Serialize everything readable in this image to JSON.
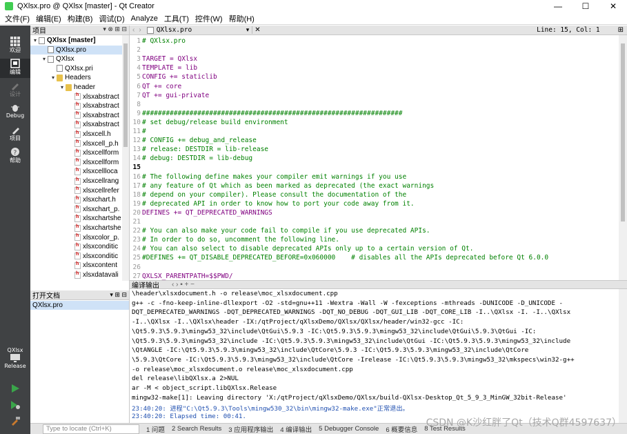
{
  "window": {
    "title": "QXlsx.pro @ QXlsx [master] - Qt Creator",
    "minimize": "—",
    "maximize": "☐",
    "close": "✕"
  },
  "menu": [
    "文件(F)",
    "编辑(E)",
    "构建(B)",
    "调试(D)",
    "Analyze",
    "工具(T)",
    "控件(W)",
    "帮助(H)"
  ],
  "modes": [
    {
      "label": "欢迎"
    },
    {
      "label": "编辑"
    },
    {
      "label": "设计"
    },
    {
      "label": "Debug"
    },
    {
      "label": "项目"
    },
    {
      "label": "帮助"
    }
  ],
  "kit": {
    "project": "QXlsx",
    "config": "Release"
  },
  "sidebar": {
    "title": "项目",
    "tree": [
      {
        "label": "QXlsx [master]",
        "bold": true,
        "arrow": "▾",
        "icon": "pro",
        "level": 0
      },
      {
        "label": "QXlsx.pro",
        "arrow": "",
        "icon": "pro",
        "level": 1,
        "selected": true
      },
      {
        "label": "QXlsx",
        "arrow": "▾",
        "icon": "pro",
        "level": 1
      },
      {
        "label": "QXlsx.pri",
        "arrow": "",
        "icon": "pro",
        "level": 2
      },
      {
        "label": "Headers",
        "arrow": "▾",
        "icon": "fold",
        "level": 2
      },
      {
        "label": "header",
        "arrow": "▾",
        "icon": "fold",
        "level": 3
      },
      {
        "label": "xlsxabstract",
        "arrow": "",
        "icon": "h",
        "level": 4
      },
      {
        "label": "xlsxabstract",
        "arrow": "",
        "icon": "h",
        "level": 4
      },
      {
        "label": "xlsxabstract",
        "arrow": "",
        "icon": "h",
        "level": 4
      },
      {
        "label": "xlsxabstract",
        "arrow": "",
        "icon": "h",
        "level": 4
      },
      {
        "label": "xlsxcell.h",
        "arrow": "",
        "icon": "h",
        "level": 4
      },
      {
        "label": "xlsxcell_p.h",
        "arrow": "",
        "icon": "h",
        "level": 4
      },
      {
        "label": "xlsxcellform",
        "arrow": "",
        "icon": "h",
        "level": 4
      },
      {
        "label": "xlsxcellform",
        "arrow": "",
        "icon": "h",
        "level": 4
      },
      {
        "label": "xlsxcellloca",
        "arrow": "",
        "icon": "h",
        "level": 4
      },
      {
        "label": "xlsxcellrang",
        "arrow": "",
        "icon": "h",
        "level": 4
      },
      {
        "label": "xlsxcellrefer",
        "arrow": "",
        "icon": "h",
        "level": 4
      },
      {
        "label": "xlsxchart.h",
        "arrow": "",
        "icon": "h",
        "level": 4
      },
      {
        "label": "xlsxchart_p.",
        "arrow": "",
        "icon": "h",
        "level": 4
      },
      {
        "label": "xlsxchartshe",
        "arrow": "",
        "icon": "h",
        "level": 4
      },
      {
        "label": "xlsxchartshe",
        "arrow": "",
        "icon": "h",
        "level": 4
      },
      {
        "label": "xlsxcolor_p.",
        "arrow": "",
        "icon": "h",
        "level": 4
      },
      {
        "label": "xlsxconditic",
        "arrow": "",
        "icon": "h",
        "level": 4
      },
      {
        "label": "xlsxconditic",
        "arrow": "",
        "icon": "h",
        "level": 4
      },
      {
        "label": "xlsxcontent",
        "arrow": "",
        "icon": "h",
        "level": 4
      },
      {
        "label": "xlsxdatavali",
        "arrow": "",
        "icon": "h",
        "level": 4
      }
    ],
    "open_title": "打开文档",
    "open_files": [
      "QXlsx.pro"
    ]
  },
  "editor": {
    "file": "QXlsx.pro",
    "position": "Line: 15, Col: 1",
    "lines": [
      {
        "n": "1",
        "t": "# QXlsx.pro",
        "c": "com"
      },
      {
        "n": "2",
        "t": "",
        "c": ""
      },
      {
        "n": "3",
        "t": "TARGET = QXlsx",
        "c": "key"
      },
      {
        "n": "4",
        "t": "TEMPLATE = lib",
        "c": "key"
      },
      {
        "n": "5",
        "t": "CONFIG += staticlib",
        "c": "key"
      },
      {
        "n": "6",
        "t": "QT += core",
        "c": "key"
      },
      {
        "n": "7",
        "t": "QT += gui-private",
        "c": "key"
      },
      {
        "n": "8",
        "t": "",
        "c": ""
      },
      {
        "n": "9",
        "t": "##################################################################",
        "c": "com"
      },
      {
        "n": "10",
        "t": "# set debug/release build environment",
        "c": "com"
      },
      {
        "n": "11",
        "t": "#",
        "c": "com"
      },
      {
        "n": "12",
        "t": "# CONFIG += debug_and_release",
        "c": "com"
      },
      {
        "n": "13",
        "t": "# release: DESTDIR = lib-release",
        "c": "com"
      },
      {
        "n": "14",
        "t": "# debug: DESTDIR = lib-debug",
        "c": "com"
      },
      {
        "n": "15",
        "t": "",
        "c": ""
      },
      {
        "n": "16",
        "t": "# The following define makes your compiler emit warnings if you use",
        "c": "com"
      },
      {
        "n": "17",
        "t": "# any feature of Qt which as been marked as deprecated (the exact warnings",
        "c": "com"
      },
      {
        "n": "18",
        "t": "# depend on your compiler). Please consult the documentation of the",
        "c": "com"
      },
      {
        "n": "19",
        "t": "# deprecated API in order to know how to port your code away from it.",
        "c": "com"
      },
      {
        "n": "20",
        "t": "DEFINES += QT_DEPRECATED_WARNINGS",
        "c": "key"
      },
      {
        "n": "21",
        "t": "",
        "c": ""
      },
      {
        "n": "22",
        "t": "# You can also make your code fail to compile if you use deprecated APIs.",
        "c": "com"
      },
      {
        "n": "23",
        "t": "# In order to do so, uncomment the following line.",
        "c": "com"
      },
      {
        "n": "24",
        "t": "# You can also select to disable deprecated APIs only up to a certain version of Qt.",
        "c": "com"
      },
      {
        "n": "25",
        "t": "#DEFINES += QT_DISABLE_DEPRECATED_BEFORE=0x060000    # disables all the APIs deprecated before Qt 6.0.0",
        "c": "com"
      },
      {
        "n": "26",
        "t": "",
        "c": ""
      },
      {
        "n": "27",
        "t": "QXLSX_PARENTPATH=$$PWD/",
        "c": "key"
      }
    ]
  },
  "output": {
    "title": "编译输出",
    "lines": [
      {
        "t": "\\header\\xlsxdocument.h -o release\\moc_xlsxdocument.cpp",
        "blue": false
      },
      {
        "t": "g++ -c -fno-keep-inline-dllexport -O2 -std=gnu++11 -Wextra -Wall -W -fexceptions -mthreads -DUNICODE -D_UNICODE -",
        "blue": false
      },
      {
        "t": "DQT_DEPRECATED_WARNINGS -DQT_DEPRECATED_WARNINGS -DQT_NO_DEBUG -DQT_GUI_LIB -DQT_CORE_LIB -I..\\QXlsx -I. -I..\\QXlsx",
        "blue": false
      },
      {
        "t": "-I..\\QXlsx -I..\\QXlsx\\header -IX:/qtProject/qXlsxDemo/QXlsx/QXlsx/header/win32-gcc -IC:",
        "blue": false
      },
      {
        "t": "\\Qt5.9.3\\5.9.3\\mingw53_32\\include\\QtGui\\5.9.3 -IC:\\Qt5.9.3\\5.9.3\\mingw53_32\\include\\QtGui\\5.9.3\\QtGui -IC:",
        "blue": false
      },
      {
        "t": "\\Qt5.9.3\\5.9.3\\mingw53_32\\include -IC:\\Qt5.9.3\\5.9.3\\mingw53_32\\include\\QtGui -IC:\\Qt5.9.3\\5.9.3\\mingw53_32\\include",
        "blue": false
      },
      {
        "t": "\\QtANGLE -IC:\\Qt5.9.3\\5.9.3\\mingw53_32\\include\\QtCore\\5.9.3 -IC:\\Qt5.9.3\\5.9.3\\mingw53_32\\include\\QtCore",
        "blue": false
      },
      {
        "t": "\\5.9.3\\QtCore -IC:\\Qt5.9.3\\5.9.3\\mingw53_32\\include\\QtCore -Irelease -IC:\\Qt5.9.3\\5.9.3\\mingw53_32\\mkspecs\\win32-g++",
        "blue": false
      },
      {
        "t": "-o release\\moc_xlsxdocument.o release\\moc_xlsxdocument.cpp",
        "blue": false
      },
      {
        "t": "del release\\libQXlsx.a 2>NUL",
        "blue": false
      },
      {
        "t": "ar -M < object_script.libQXlsx.Release",
        "blue": false
      },
      {
        "t": "mingw32-make[1]: Leaving directory 'X:/qtProject/qXlsxDemo/QXlsx/build-QXlsx-Desktop_Qt_5_9_3_MinGW_32bit-Release'",
        "blue": false
      },
      {
        "t": "23:40:20: 进程\"C:\\Qt5.9.3\\Tools\\mingw530_32\\bin\\mingw32-make.exe\"正常退出。",
        "blue": true
      },
      {
        "t": "23:40:20: Elapsed time: 00:41.",
        "blue": true
      }
    ]
  },
  "status": {
    "locator_placeholder": "Type to locate (Ctrl+K)",
    "tabs": [
      "1 问题",
      "2 Search Results",
      "3 应用程序输出",
      "4 编译输出",
      "5 Debugger Console",
      "6 概要信息",
      "8 Test Results"
    ]
  },
  "watermark": "CSDN @K沙红胖了Qt（技术Q群4597637）",
  "colors": {
    "mode_bar": "#404244",
    "comment": "#008000",
    "keyword": "#800080",
    "output_info": "#1f4fb0",
    "selection": "#cfe2f7"
  }
}
